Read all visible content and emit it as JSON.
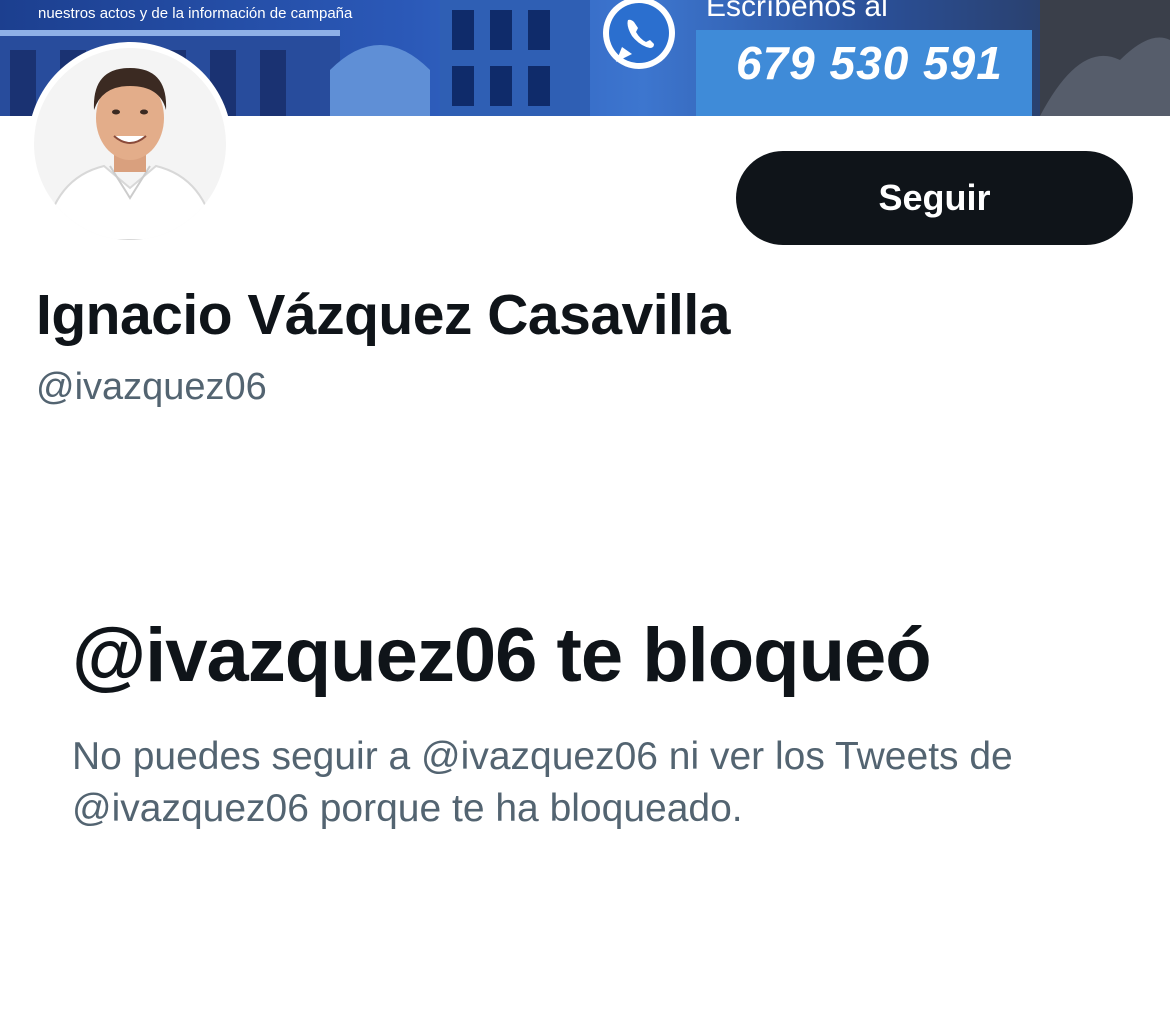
{
  "banner": {
    "caption": "nuestros actos y de la información de campaña",
    "write_text": "Escríbenos al",
    "phone": "679 530 591",
    "icon": "whatsapp-icon"
  },
  "profile": {
    "avatar_icon": "profile-photo",
    "follow_label": "Seguir",
    "display_name": "Ignacio Vázquez Casavilla",
    "handle": "@ivazquez06"
  },
  "blocked": {
    "title": "@ivazquez06 te bloqueó",
    "description": "No puedes seguir a @ivazquez06 ni ver los Tweets de @ivazquez06 porque te ha bloqueado."
  },
  "colors": {
    "primary_text": "#0f1419",
    "secondary_text": "#536471",
    "button_bg": "#0f1419",
    "banner_blue": "#2b59b8"
  }
}
